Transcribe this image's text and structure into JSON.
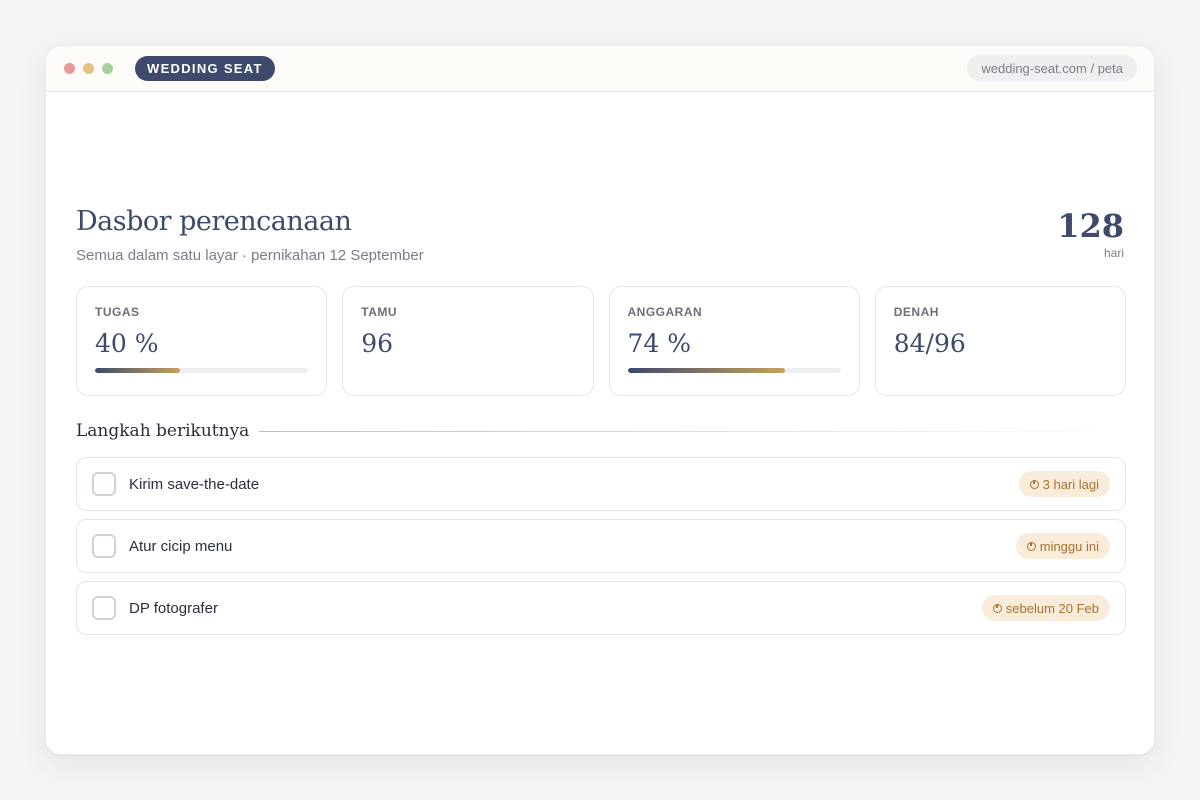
{
  "window": {
    "brand": "WEDDING SEAT",
    "url": "wedding-seat.com / peta"
  },
  "header": {
    "title": "Dasbor perencanaan",
    "subtitle": "Semua dalam satu layar · pernikahan 12 September",
    "countdown": {
      "value": "128",
      "unit": "hari"
    }
  },
  "stats": [
    {
      "label": "TUGAS",
      "value": "40 %",
      "progress": 0.4
    },
    {
      "label": "TAMU",
      "value": "96"
    },
    {
      "label": "ANGGARAN",
      "value": "74 %",
      "progress": 0.74
    },
    {
      "label": "DENAH",
      "value": "84/96"
    }
  ],
  "next_steps": {
    "title": "Langkah berikutnya",
    "items": [
      {
        "label": "Kirim save-the-date",
        "due": "3 hari lagi",
        "checked": false
      },
      {
        "label": "Atur cicip menu",
        "due": "minggu ini",
        "checked": false
      },
      {
        "label": "DP fotografer",
        "due": "sebelum 20 Feb",
        "checked": false
      }
    ]
  },
  "colors": {
    "primary": "#3d4a6b",
    "accent": "#c9a25c",
    "badge_bg": "#f9ecdb",
    "badge_text": "#a8722e"
  }
}
